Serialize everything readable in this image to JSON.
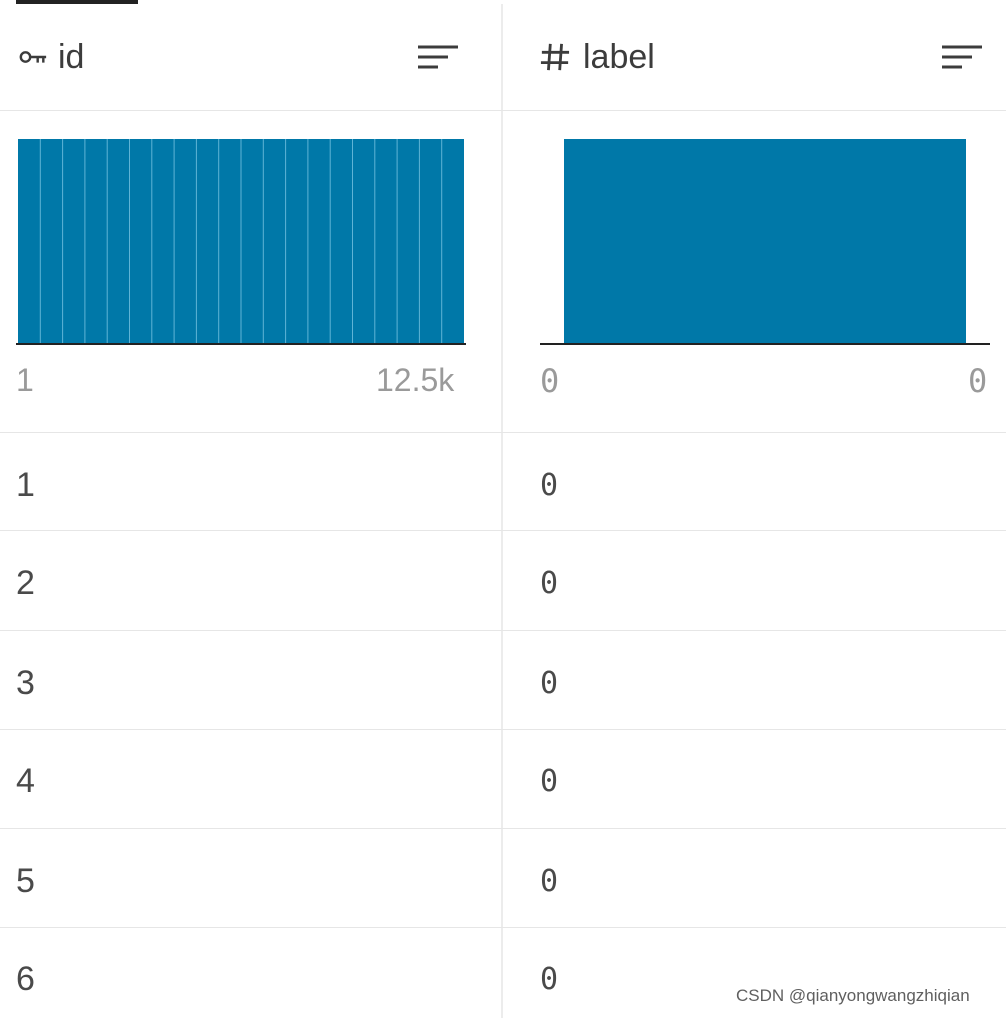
{
  "columns": [
    {
      "name": "id",
      "type_icon": "key-icon",
      "sort_icon": "sort-icon",
      "histogram": {
        "min_label": "1",
        "max_label": "12.5k"
      }
    },
    {
      "name": "label",
      "type_icon": "hash-icon",
      "sort_icon": "sort-icon",
      "histogram": {
        "min_label": "0",
        "max_label": "0"
      }
    }
  ],
  "rows": [
    {
      "id": "1",
      "label": "0"
    },
    {
      "id": "2",
      "label": "0"
    },
    {
      "id": "3",
      "label": "0"
    },
    {
      "id": "4",
      "label": "0"
    },
    {
      "id": "5",
      "label": "0"
    },
    {
      "id": "6",
      "label": "0"
    }
  ],
  "colors": {
    "bar": "#0078a8",
    "bar_divider": "#5fb4d6",
    "baseline": "#222222",
    "text": "#3c3c3c",
    "muted": "#9a9a9a"
  },
  "watermark": "CSDN @qianyongwangzhiqian"
}
